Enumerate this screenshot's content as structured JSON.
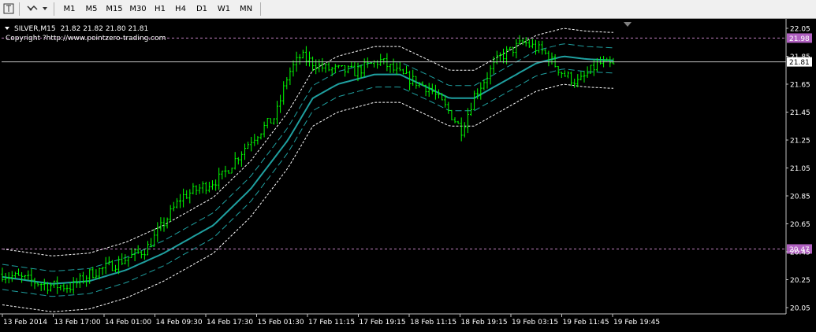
{
  "toolbar": {
    "timeframes": [
      "M1",
      "M5",
      "M15",
      "M30",
      "H1",
      "H4",
      "D1",
      "W1",
      "MN"
    ]
  },
  "info": {
    "symbol": "SILVER,M15",
    "ohlc": "21.82 21.82 21.80 21.81",
    "copyright": "Copyright ?http://www.pointzero-trading.com"
  },
  "colors": {
    "background": "#000000",
    "candles": "#00ff00",
    "midline": "#1fa0a0",
    "inner_band": "#1fa0a0",
    "outer_band": "#ffffff",
    "level_line": "#c080c0",
    "level_label_bg": "#b060c0",
    "price_line": "#c0c0c0"
  },
  "chart_data": {
    "type": "candlestick",
    "symbol": "SILVER",
    "timeframe": "M15",
    "ylim": [
      20.0,
      22.1
    ],
    "y_ticks": [
      "22.05",
      "21.85",
      "21.65",
      "21.45",
      "21.25",
      "21.05",
      "20.85",
      "20.65",
      "20.45",
      "20.25",
      "20.05"
    ],
    "x_ticks": [
      "13 Feb 2014",
      "13 Feb 17:00",
      "14 Feb 01:00",
      "14 Feb 09:30",
      "14 Feb 17:30",
      "15 Feb 01:30",
      "17 Feb 11:15",
      "17 Feb 19:15",
      "18 Feb 11:15",
      "18 Feb 19:15",
      "19 Feb 03:15",
      "19 Feb 11:45",
      "19 Feb 19:45"
    ],
    "bar_count": 190,
    "levels": [
      {
        "value": 21.98,
        "label": "21.98"
      },
      {
        "value": 20.47,
        "label": "20.47"
      }
    ],
    "current_price": {
      "value": 21.81,
      "label": "21.81"
    },
    "price_path": [
      [
        0,
        20.29
      ],
      [
        10,
        20.25
      ],
      [
        18,
        20.21
      ],
      [
        28,
        20.2
      ],
      [
        35,
        20.29
      ],
      [
        45,
        20.36
      ],
      [
        58,
        20.47
      ],
      [
        72,
        20.84
      ],
      [
        88,
        20.98
      ],
      [
        100,
        21.25
      ],
      [
        110,
        21.42
      ],
      [
        115,
        21.72
      ],
      [
        120,
        21.85
      ],
      [
        130,
        21.76
      ],
      [
        142,
        21.74
      ],
      [
        152,
        21.82
      ],
      [
        160,
        21.72
      ],
      [
        172,
        21.62
      ],
      [
        180,
        21.45
      ],
      [
        185,
        21.32
      ],
      [
        190,
        21.57
      ],
      [
        200,
        21.84
      ],
      [
        210,
        21.95
      ],
      [
        218,
        21.88
      ],
      [
        226,
        21.72
      ],
      [
        232,
        21.66
      ],
      [
        240,
        21.8
      ],
      [
        246,
        21.78
      ]
    ],
    "midline_path": [
      [
        0,
        20.27
      ],
      [
        20,
        20.22
      ],
      [
        35,
        20.24
      ],
      [
        50,
        20.32
      ],
      [
        65,
        20.44
      ],
      [
        85,
        20.64
      ],
      [
        100,
        20.9
      ],
      [
        115,
        21.25
      ],
      [
        125,
        21.55
      ],
      [
        135,
        21.65
      ],
      [
        150,
        21.72
      ],
      [
        160,
        21.72
      ],
      [
        172,
        21.62
      ],
      [
        180,
        21.55
      ],
      [
        190,
        21.55
      ],
      [
        200,
        21.65
      ],
      [
        215,
        21.8
      ],
      [
        226,
        21.85
      ],
      [
        235,
        21.83
      ],
      [
        246,
        21.82
      ]
    ],
    "band_offsets": {
      "inner": 0.09,
      "outer": 0.2
    }
  }
}
